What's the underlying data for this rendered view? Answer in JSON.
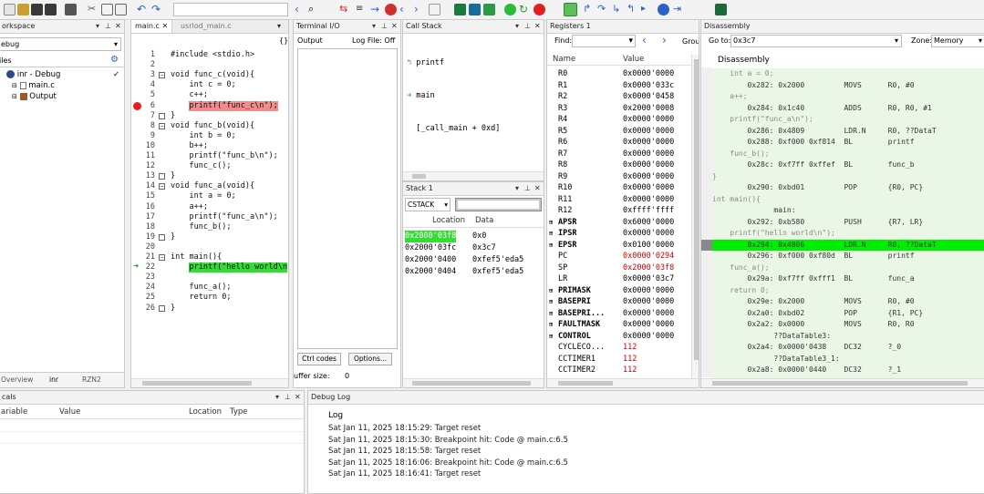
{
  "colors": {
    "accent": "#00ee00",
    "breakpoint": "#e02020",
    "highlight_red": "#f28b8b",
    "pc_green": "#33dd33",
    "value_changed": "#d00000",
    "disasm_bg": "#eaf7e6"
  },
  "workspace": {
    "title": "orkspace",
    "config": "ebug",
    "files_label": "iles",
    "project": "inr - Debug",
    "items": [
      "main.c",
      "Output"
    ],
    "bottom_tabs": [
      "Overview",
      "inr",
      "RZN2"
    ]
  },
  "editor": {
    "tabs": [
      "main.c",
      "usrlod_main.c"
    ],
    "lines": [
      {
        "n": "1",
        "t": "#include <stdio.h>"
      },
      {
        "n": "2",
        "t": ""
      },
      {
        "n": "3",
        "t": "void func_c(void){"
      },
      {
        "n": "4",
        "t": "    int c = 0;"
      },
      {
        "n": "5",
        "t": "    c++;"
      },
      {
        "n": "6",
        "t": "    printf(\"func_c\\n\");"
      },
      {
        "n": "7",
        "t": "}"
      },
      {
        "n": "8",
        "t": "void func_b(void){"
      },
      {
        "n": "9",
        "t": "    int b = 0;"
      },
      {
        "n": "10",
        "t": "    b++;"
      },
      {
        "n": "11",
        "t": "    printf(\"func_b\\n\");"
      },
      {
        "n": "12",
        "t": "    func_c();"
      },
      {
        "n": "13",
        "t": "}"
      },
      {
        "n": "14",
        "t": "void func_a(void){"
      },
      {
        "n": "15",
        "t": "    int a = 0;"
      },
      {
        "n": "16",
        "t": "    a++;"
      },
      {
        "n": "17",
        "t": "    printf(\"func_a\\n\");"
      },
      {
        "n": "18",
        "t": "    func_b();"
      },
      {
        "n": "19",
        "t": "}"
      },
      {
        "n": "20",
        "t": ""
      },
      {
        "n": "21",
        "t": "int main(){"
      },
      {
        "n": "22",
        "t": "    printf(\"hello world\\n"
      },
      {
        "n": "23",
        "t": ""
      },
      {
        "n": "24",
        "t": "    func_a();"
      },
      {
        "n": "25",
        "t": "    return 0;"
      },
      {
        "n": "26",
        "t": "}"
      }
    ]
  },
  "terminal": {
    "title": "Terminal I/O",
    "output_label": "Output",
    "log_file": "Log File: Off",
    "ctrl_codes": "Ctrl codes",
    "options": "Options...",
    "buffer_label": "uffer size:",
    "buffer_value": "0"
  },
  "callstack": {
    "title": "Call Stack",
    "items": [
      "printf",
      "main",
      "[_call_main + 0xd]"
    ]
  },
  "stack": {
    "title": "Stack 1",
    "select": "CSTACK",
    "headers": [
      "Location",
      "Data"
    ],
    "rows": [
      [
        "0x2000'03f8",
        "0x0"
      ],
      [
        "0x2000'03fc",
        "0x3c7"
      ],
      [
        "0x2000'0400",
        "0xfef5'eda5"
      ],
      [
        "0x2000'0404",
        "0xfef5'eda5"
      ]
    ]
  },
  "registers": {
    "title": "Registers 1",
    "find_label": "Find:",
    "group_label": "Grou",
    "headers": [
      "Name",
      "Value"
    ],
    "rows": [
      [
        "R0",
        "0x0000'0000",
        false
      ],
      [
        "R1",
        "0x0000'033c",
        false
      ],
      [
        "R2",
        "0x0000'0458",
        false
      ],
      [
        "R3",
        "0x2000'0008",
        false
      ],
      [
        "R4",
        "0x0000'0000",
        false
      ],
      [
        "R5",
        "0x0000'0000",
        false
      ],
      [
        "R6",
        "0x0000'0000",
        false
      ],
      [
        "R7",
        "0x0000'0000",
        false
      ],
      [
        "R8",
        "0x0000'0000",
        false
      ],
      [
        "R9",
        "0x0000'0000",
        false
      ],
      [
        "R10",
        "0x0000'0000",
        false
      ],
      [
        "R11",
        "0x0000'0000",
        false
      ],
      [
        "R12",
        "0xffff'ffff",
        false
      ],
      [
        "APSR",
        "0x6000'0000",
        false
      ],
      [
        "IPSR",
        "0x0000'0000",
        false
      ],
      [
        "EPSR",
        "0x0100'0000",
        false
      ],
      [
        "PC",
        "0x0000'0294",
        true
      ],
      [
        "SP",
        "0x2000'03f8",
        true
      ],
      [
        "LR",
        "0x0000'03c7",
        false
      ],
      [
        "PRIMASK",
        "0x0000'0000",
        false
      ],
      [
        "BASEPRI",
        "0x0000'0000",
        false
      ],
      [
        "BASEPRI...",
        "0x0000'0000",
        false
      ],
      [
        "FAULTMASK",
        "0x0000'0000",
        false
      ],
      [
        "CONTROL",
        "0x0000'0000",
        false
      ],
      [
        "CYCLECO...",
        "112",
        true
      ],
      [
        "CCTIMER1",
        "112",
        true
      ],
      [
        "CCTIMER2",
        "112",
        true
      ]
    ]
  },
  "disassembly": {
    "title": "Disassembly",
    "goto_label": "Go to:",
    "goto_value": "0x3c7",
    "zone_label": "Zone:",
    "zone_value": "Memory",
    "header": "Disassembly",
    "lines": [
      "    int a = 0;",
      "        0x282: 0x2000         MOVS      R0, #0",
      "    a++;",
      "        0x284: 0x1c40         ADDS      R0, R0, #1",
      "    printf(\"func_a\\n\");",
      "        0x286: 0x4809         LDR.N     R0, ??DataT",
      "        0x288: 0xf000 0xf814  BL        printf",
      "    func_b();",
      "        0x28c: 0xf7ff 0xffef  BL        func_b",
      "}",
      "        0x290: 0xbd01         POP       {R0, PC}",
      "int main(){",
      "              main:",
      "        0x292: 0xb580         PUSH      {R7, LR}",
      "    printf(\"hello world\\n\");",
      "        0x294: 0x4806         LDR.N     R0, ??DataT",
      "        0x296: 0xf000 0xf80d  BL        printf",
      "    func_a();",
      "        0x29a: 0xf7ff 0xfff1  BL        func_a",
      "    return 0;",
      "        0x29e: 0x2000         MOVS      R0, #0",
      "        0x2a0: 0xbd02         POP       {R1, PC}",
      "        0x2a2: 0x0000         MOVS      R0, R0",
      "              ??DataTable3:",
      "        0x2a4: 0x0000'0438    DC32      ?_0",
      "              ??DataTable3_1:",
      "        0x2a8: 0x0000'0440    DC32      ?_1"
    ]
  },
  "locals": {
    "title": "cals",
    "headers": [
      "ariable",
      "Value",
      "Location",
      "Type"
    ]
  },
  "debuglog": {
    "title": "Debug Log",
    "header": "Log",
    "entries": [
      "Sat Jan 11, 2025 18:15:29: Target reset",
      "Sat Jan 11, 2025 18:15:30: Breakpoint hit: Code @ main.c:6.5",
      "Sat Jan 11, 2025 18:15:58: Target reset",
      "Sat Jan 11, 2025 18:16:06: Breakpoint hit: Code @ main.c:6.5",
      "Sat Jan 11, 2025 18:16:41: Target reset"
    ]
  }
}
